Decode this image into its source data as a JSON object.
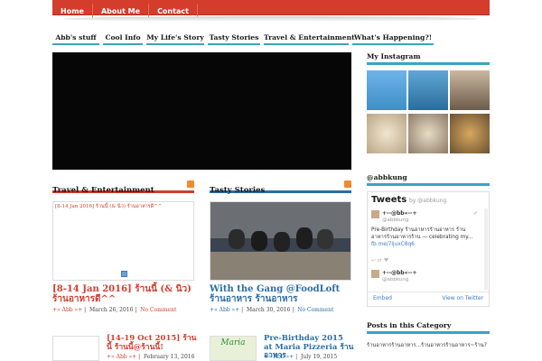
{
  "topnav": [
    "Home",
    "About Me",
    "Contact"
  ],
  "catnav": [
    "Abb's stuff",
    "Cool Info",
    "My Life's Story",
    "Tasty Stories",
    "Travel & Entertainment",
    "What's Happening?!"
  ],
  "sections": {
    "left_title": "Travel & Entertainment",
    "mid_title": "Tasty Stories"
  },
  "posts": {
    "travel_caption": "[8-14 Jan 2016] ร้านนี้ (& นิว) ร้านอาหารดี^^",
    "travel_title": "[8-14 Jan 2016] ร้านนี้ (& นิว) ร้านอาหารดี^^",
    "travel_author": "+« Abb »+",
    "travel_date": "March 26, 2016",
    "travel_comments": "No Comment",
    "tasty_title": "With the Gang @FoodLoft ร้านอาหาร ร้านอาหาร",
    "tasty_author": "+« Abb »+",
    "tasty_date": "March 30, 2016",
    "tasty_comments": "No Comment",
    "p3_title": "[14-19 Oct 2015] ร้านนี้ ร้านนี้@ร้านนี้!",
    "p3_author": "+« Abb »+",
    "p3_date": "February 13, 2016",
    "p4_title": "Pre-Birthday 2015 at Maria Pizzeria ร้านอาหาร",
    "p4_author": "+« Abb »+",
    "p4_date": "July 19, 2015",
    "p4_img_label": "Maria"
  },
  "sidebar": {
    "instagram_title": "My Instagram",
    "twitter_title": "@abbkung",
    "tweets_label": "Tweets",
    "tweets_by": "by @abbkung",
    "tweet1_name": "+--@bb«--+",
    "tweet1_handle": "@abbkung",
    "tweet1_text": "Pre-Birthday ร้านอาหารร้านอาหาร ร้านอาหารร้านอาหารร้าน — celebrating my...",
    "tweet1_link": "fb.me/7ljuxC8q6",
    "tweet2_name": "+--@bb«--+",
    "tweet2_handle": "@abbkung",
    "embed": "Embed",
    "view": "View on Twitter",
    "posts_cat_title": "Posts in this Category",
    "posts_cat_item": "ร้านอาหารร้านอาหาร...ร้านอาหารร้านอาหาร~ร้าน?"
  },
  "colors": {
    "accent": "#d43c2c",
    "blue": "#2a6ea6",
    "teal": "#3aa3c7"
  }
}
